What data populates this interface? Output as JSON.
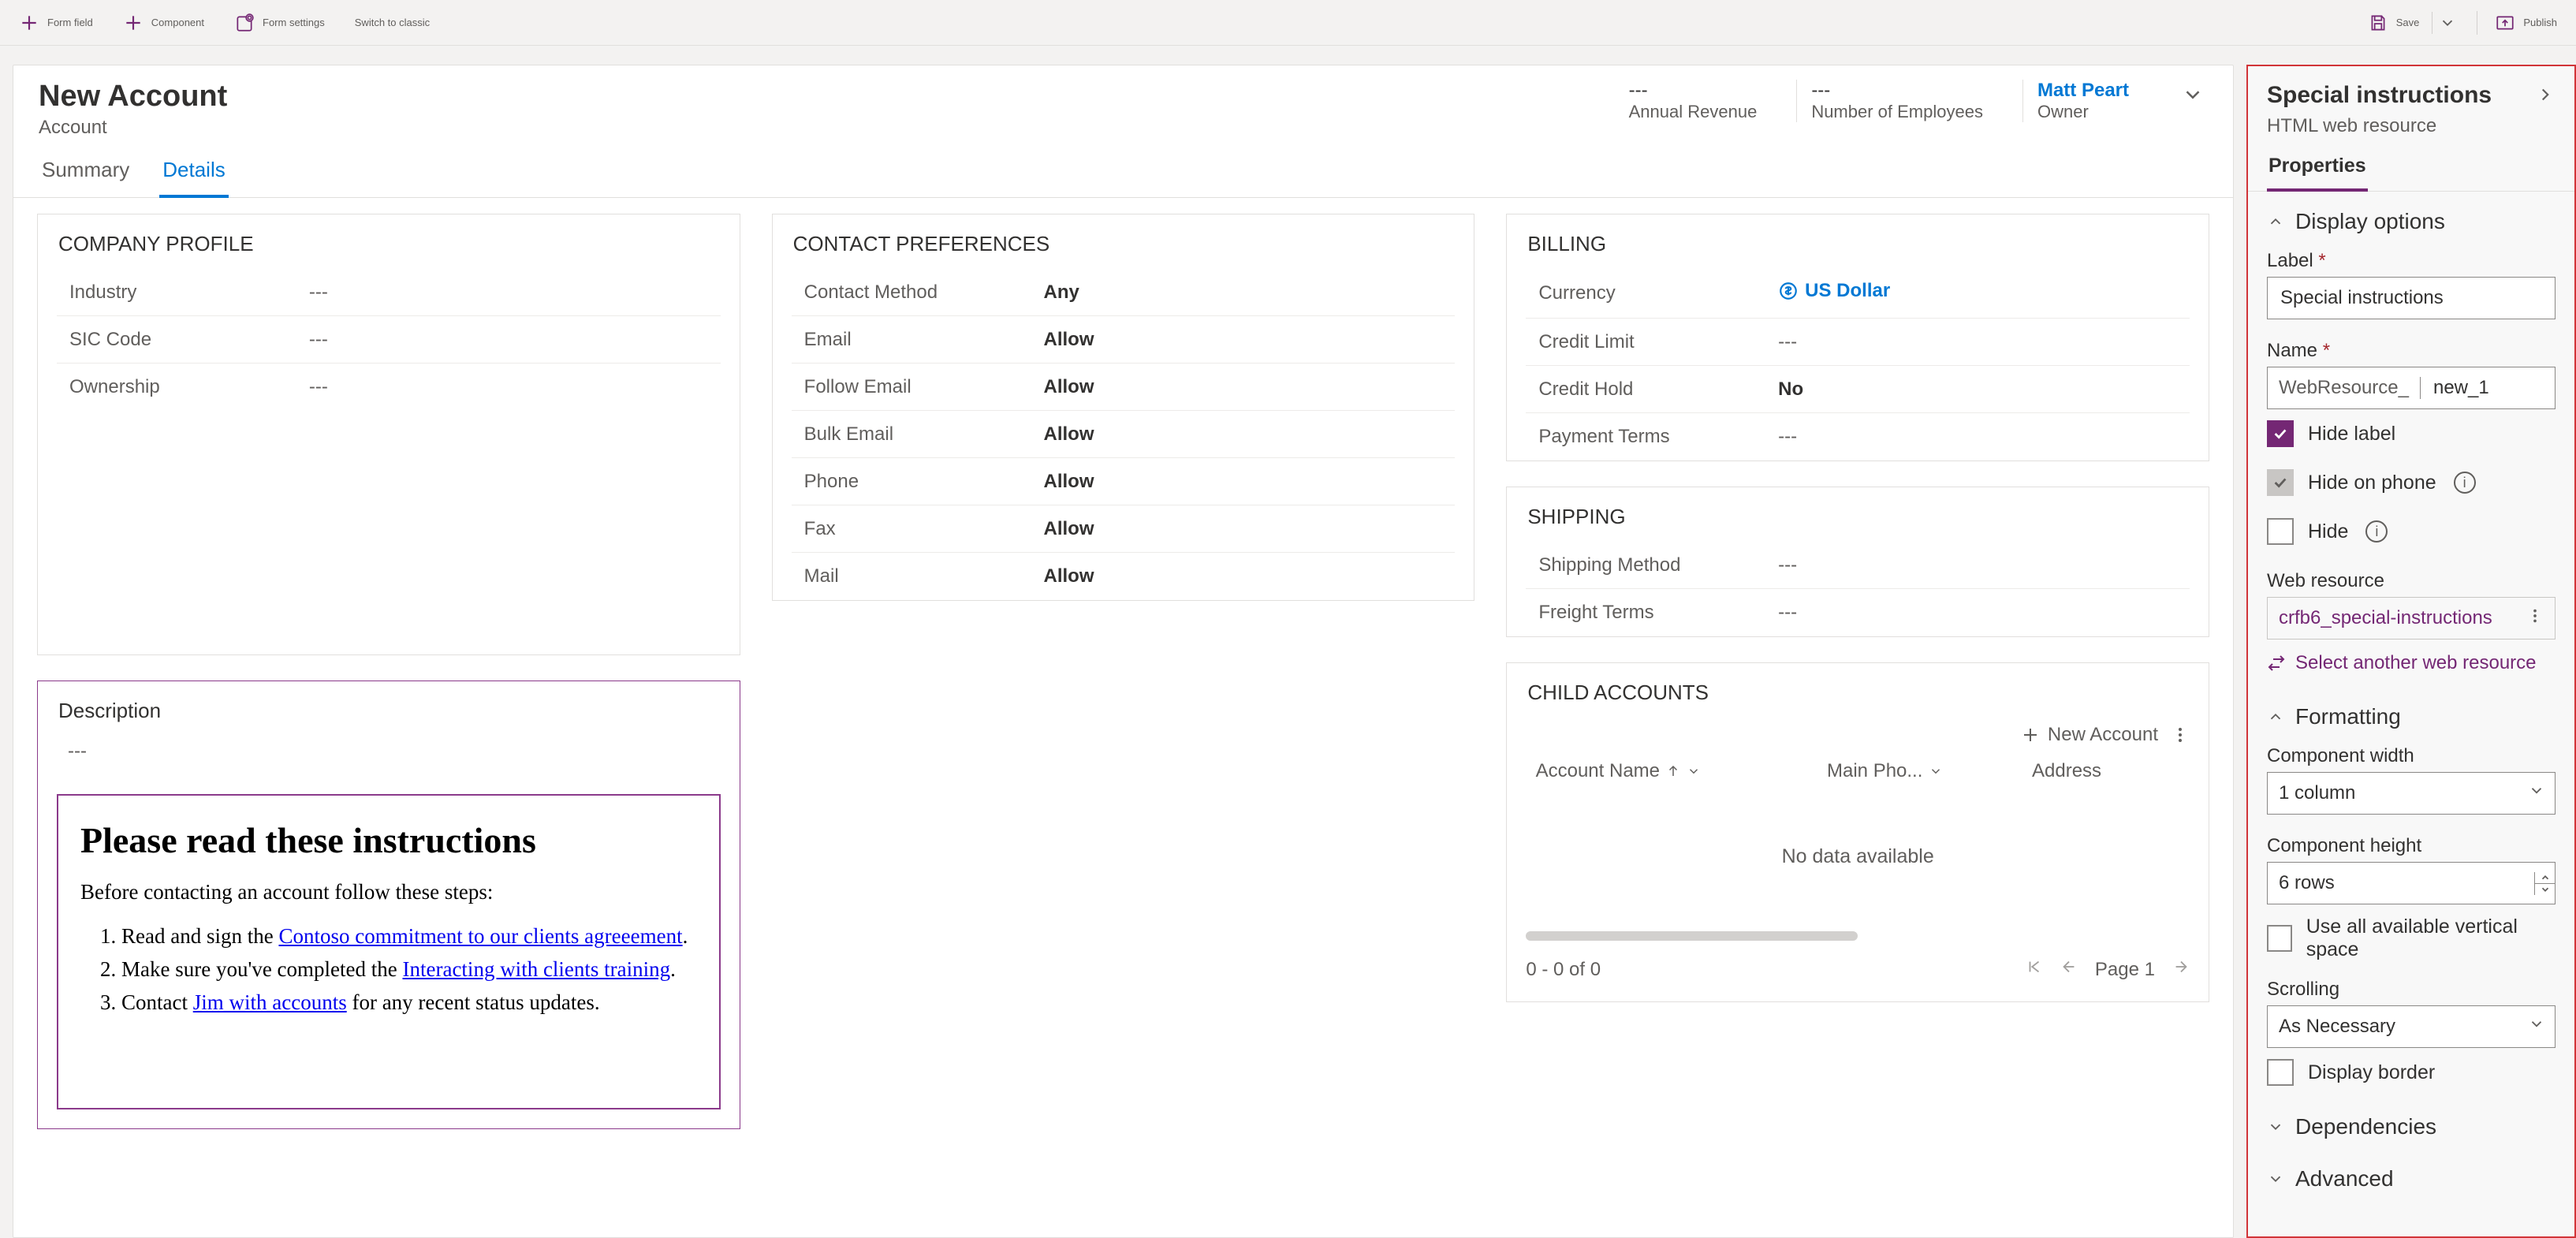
{
  "commandBar": {
    "formField": "Form field",
    "component": "Component",
    "formSettings": "Form settings",
    "switchToClassic": "Switch to classic",
    "save": "Save",
    "publish": "Publish"
  },
  "header": {
    "title": "New Account",
    "entity": "Account",
    "annualRevenueValue": "---",
    "annualRevenueLabel": "Annual Revenue",
    "employeesValue": "---",
    "employeesLabel": "Number of Employees",
    "ownerValue": "Matt Peart",
    "ownerLabel": "Owner"
  },
  "tabs": {
    "summary": "Summary",
    "details": "Details"
  },
  "sections": {
    "companyProfile": {
      "title": "COMPANY PROFILE",
      "industryLabel": "Industry",
      "industryValue": "---",
      "sicLabel": "SIC Code",
      "sicValue": "---",
      "ownershipLabel": "Ownership",
      "ownershipValue": "---"
    },
    "description": {
      "title": "Description",
      "value": "---"
    },
    "webResource": {
      "heading": "Please read these instructions",
      "intro": "Before contacting an account follow these steps:",
      "step1a": "Read and sign the ",
      "step1link": "Contoso commitment to our clients agreeement",
      "step1b": ".",
      "step2a": "Make sure you've completed the ",
      "step2link": "Interacting with clients training",
      "step2b": ".",
      "step3a": "Contact ",
      "step3link": "Jim with accounts",
      "step3b": " for any recent status updates."
    },
    "contactPrefs": {
      "title": "CONTACT PREFERENCES",
      "contactMethodLabel": "Contact Method",
      "contactMethodValue": "Any",
      "emailLabel": "Email",
      "emailValue": "Allow",
      "followEmailLabel": "Follow Email",
      "followEmailValue": "Allow",
      "bulkEmailLabel": "Bulk Email",
      "bulkEmailValue": "Allow",
      "phoneLabel": "Phone",
      "phoneValue": "Allow",
      "faxLabel": "Fax",
      "faxValue": "Allow",
      "mailLabel": "Mail",
      "mailValue": "Allow"
    },
    "billing": {
      "title": "BILLING",
      "currencyLabel": "Currency",
      "currencyValue": "US Dollar",
      "creditLimitLabel": "Credit Limit",
      "creditLimitValue": "---",
      "creditHoldLabel": "Credit Hold",
      "creditHoldValue": "No",
      "paymentTermsLabel": "Payment Terms",
      "paymentTermsValue": "---"
    },
    "shipping": {
      "title": "SHIPPING",
      "shippingMethodLabel": "Shipping Method",
      "shippingMethodValue": "---",
      "freightTermsLabel": "Freight Terms",
      "freightTermsValue": "---"
    },
    "childAccounts": {
      "title": "CHILD ACCOUNTS",
      "newAccount": "New Account",
      "colAccountName": "Account Name",
      "colMainPhone": "Main Pho...",
      "colAddress": "Address",
      "noData": "No data available",
      "rowCount": "0 - 0 of 0",
      "pageLabel": "Page 1"
    }
  },
  "props": {
    "title": "Special instructions",
    "subtitle": "HTML web resource",
    "tabLabel": "Properties",
    "displayOptions": "Display options",
    "labelLabel": "Label",
    "labelValue": "Special instructions",
    "nameLabel": "Name",
    "namePrefix": "WebResource_",
    "nameValue": "new_1",
    "hideLabel": "Hide label",
    "hideOnPhone": "Hide on phone",
    "hide": "Hide",
    "webResourceLabel": "Web resource",
    "webResourceValue": "crfb6_special-instructions",
    "selectAnother": "Select another web resource",
    "formatting": "Formatting",
    "widthLabel": "Component width",
    "widthValue": "1 column",
    "heightLabel": "Component height",
    "heightValue": "6 rows",
    "useAllVertical": "Use all available vertical space",
    "scrollingLabel": "Scrolling",
    "scrollingValue": "As Necessary",
    "displayBorder": "Display border",
    "dependencies": "Dependencies",
    "advanced": "Advanced"
  }
}
